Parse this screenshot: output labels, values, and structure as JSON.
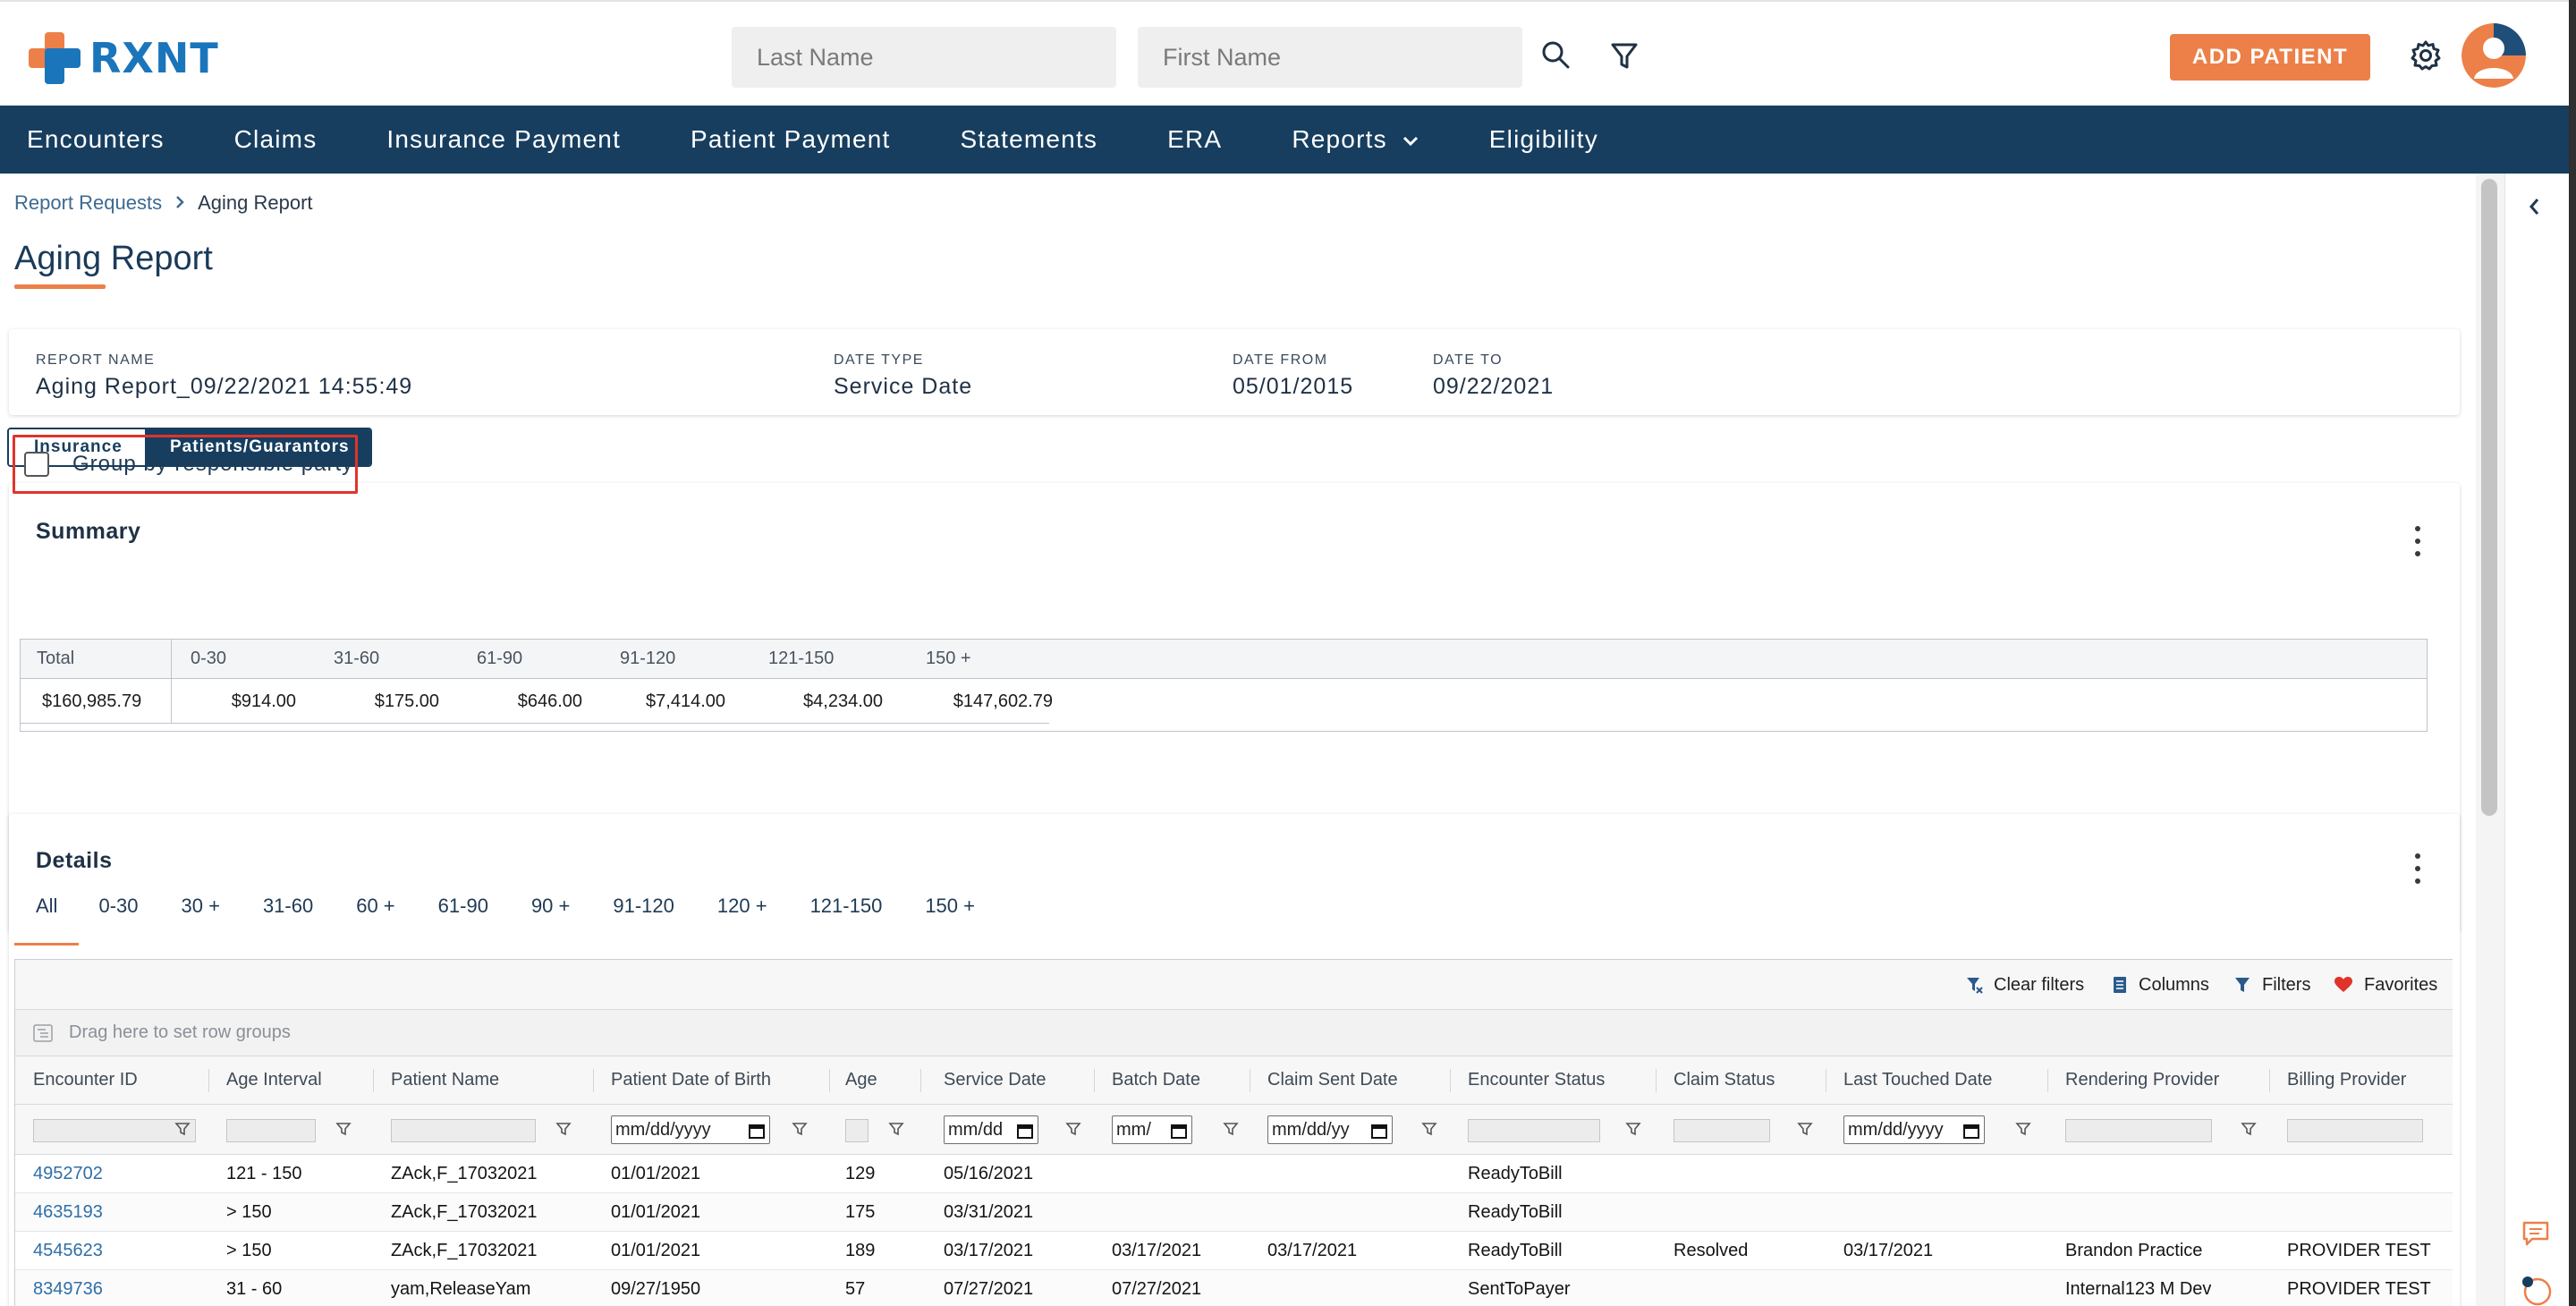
{
  "header": {
    "logo_text": "RXNT",
    "last_name_placeholder": "Last Name",
    "first_name_placeholder": "First Name",
    "add_patient_label": "ADD PATIENT",
    "brand_blue": "#1b75bb",
    "accent_orange": "#ec8048"
  },
  "nav": {
    "items": [
      "Encounters",
      "Claims",
      "Insurance Payment",
      "Patient Payment",
      "Statements",
      "ERA",
      "Reports",
      "Eligibility"
    ],
    "bg_color": "#173e5f"
  },
  "breadcrumb": {
    "parent": "Report Requests",
    "current": "Aging Report"
  },
  "page_title": "Aging Report",
  "report_info": {
    "report_name_label": "REPORT NAME",
    "report_name": "Aging Report_09/22/2021 14:55:49",
    "date_type_label": "DATE TYPE",
    "date_type": "Service Date",
    "date_from_label": "DATE FROM",
    "date_from": "05/01/2015",
    "date_to_label": "DATE TO",
    "date_to": "09/22/2021"
  },
  "view_toggle": {
    "options": [
      "Insurance",
      "Patients/Guarantors"
    ],
    "selected": "Patients/Guarantors"
  },
  "summary": {
    "title": "Summary",
    "group_by_label": "Group by responsible party",
    "group_by_checked": false,
    "headers": [
      "Total",
      "0-30",
      "31-60",
      "61-90",
      "91-120",
      "121-150",
      "150 +"
    ],
    "values": [
      "$160,985.79",
      "$914.00",
      "$175.00",
      "$646.00",
      "$7,414.00",
      "$4,234.00",
      "$147,602.79"
    ]
  },
  "details": {
    "title": "Details",
    "tabs": [
      "All",
      "0-30",
      "30 +",
      "31-60",
      "60 +",
      "61-90",
      "90 +",
      "91-120",
      "120 +",
      "121-150",
      "150 +"
    ],
    "active_tab": "All",
    "toolbar": [
      "Clear filters",
      "Columns",
      "Filters",
      "Favorites"
    ],
    "group_drop_text": "Drag here to set row groups",
    "columns": [
      "Encounter ID",
      "Age Interval",
      "Patient Name",
      "Patient Date of Birth",
      "Age",
      "Service Date",
      "Batch Date",
      "Claim Sent Date",
      "Encounter Status",
      "Claim Status",
      "Last Touched Date",
      "Rendering Provider",
      "Billing Provider"
    ],
    "date_placeholders": {
      "dob": "mm/dd/yyyy",
      "service": "mm/dd",
      "batch": "mm/",
      "claim_sent": "mm/dd/yy",
      "last_touched": "mm/dd/yyyy"
    },
    "rows": [
      [
        "4952702",
        "121 - 150",
        "ZAck,F_17032021",
        "01/01/2021",
        "129",
        "05/16/2021",
        "",
        "",
        "ReadyToBill",
        "",
        "",
        "",
        ""
      ],
      [
        "4635193",
        "> 150",
        "ZAck,F_17032021",
        "01/01/2021",
        "175",
        "03/31/2021",
        "",
        "",
        "ReadyToBill",
        "",
        "",
        "",
        ""
      ],
      [
        "4545623",
        "> 150",
        "ZAck,F_17032021",
        "01/01/2021",
        "189",
        "03/17/2021",
        "03/17/2021",
        "03/17/2021",
        "ReadyToBill",
        "Resolved",
        "03/17/2021",
        "Brandon Practice",
        "PROVIDER TEST"
      ],
      [
        "8349736",
        "31 - 60",
        "yam,ReleaseYam",
        "09/27/1950",
        "57",
        "07/27/2021",
        "07/27/2021",
        "",
        "SentToPayer",
        "",
        "",
        "Internal123 M Dev",
        "PROVIDER TEST"
      ]
    ]
  }
}
